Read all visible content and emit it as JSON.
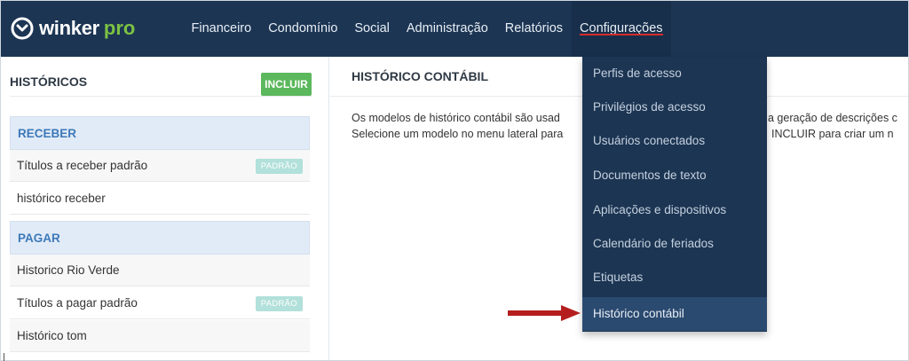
{
  "header": {
    "logo_text": "winker",
    "logo_accent": "pro",
    "nav": [
      {
        "label": "Financeiro"
      },
      {
        "label": "Condomínio"
      },
      {
        "label": "Social"
      },
      {
        "label": "Administração"
      },
      {
        "label": "Relatórios"
      },
      {
        "label": "Configurações",
        "active": true
      }
    ]
  },
  "sidebar": {
    "title": "HISTÓRICOS",
    "add_button": "INCLUIR",
    "groups": [
      {
        "label": "RECEBER",
        "items": [
          {
            "label": "Títulos a receber padrão",
            "badge": "PADRÃO"
          },
          {
            "label": "histórico receber"
          }
        ]
      },
      {
        "label": "PAGAR",
        "items": [
          {
            "label": "Historico Rio Verde"
          },
          {
            "label": "Títulos a pagar padrão",
            "badge": "PADRÃO"
          },
          {
            "label": "Histórico tom"
          }
        ]
      }
    ]
  },
  "main": {
    "title": "HISTÓRICO CONTÁBIL",
    "line1_start": "Os modelos de histórico contábil são usad",
    "line1_end": "a geração de descrições c",
    "line2_start": "Selecione um modelo no menu lateral para",
    "line2_end": "INCLUIR para criar um n"
  },
  "dropdown": {
    "items": [
      {
        "label": "Perfis de acesso"
      },
      {
        "label": "Privilégios de acesso"
      },
      {
        "label": "Usuários conectados"
      },
      {
        "label": "Documentos de texto"
      },
      {
        "label": "Aplicações e dispositivos"
      },
      {
        "label": "Calendário de feriados"
      },
      {
        "label": "Etiquetas"
      },
      {
        "label": "Histórico contábil",
        "highlighted": true
      }
    ]
  },
  "colors": {
    "topbar": "#1c3553",
    "accent_green": "#7cc243",
    "button_green": "#5cb85c",
    "group_header_bg": "#e1ebf7",
    "group_header_text": "#3d79b8",
    "badge": "#b2e0da",
    "active_underline": "#d62b2b",
    "arrow": "#b41e1e"
  },
  "icons": {
    "logo": "winker-logo-icon",
    "pointer": "red-arrow-icon"
  }
}
